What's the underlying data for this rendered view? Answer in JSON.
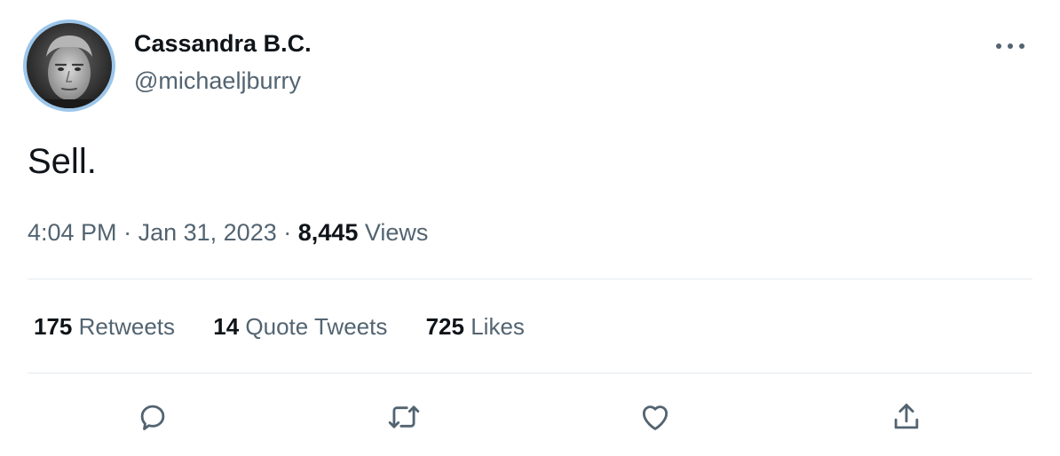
{
  "user": {
    "display_name": "Cassandra B.C.",
    "handle": "@michaeljburry",
    "avatar_border_color": "#9cc6ea"
  },
  "tweet": {
    "text": "Sell.",
    "time": "4:04 PM",
    "separator": "·",
    "date": "Jan 31, 2023",
    "views_count": "8,445",
    "views_label": "Views"
  },
  "stats": {
    "retweets": {
      "count": "175",
      "label": "Retweets"
    },
    "quote_tweets": {
      "count": "14",
      "label": "Quote Tweets"
    },
    "likes": {
      "count": "725",
      "label": "Likes"
    }
  },
  "actions": {
    "reply_icon": "reply-icon",
    "retweet_icon": "retweet-icon",
    "like_icon": "heart-icon",
    "share_icon": "share-icon"
  },
  "colors": {
    "text_primary": "#0f1419",
    "text_secondary": "#536471",
    "divider": "#e6ecf0"
  }
}
